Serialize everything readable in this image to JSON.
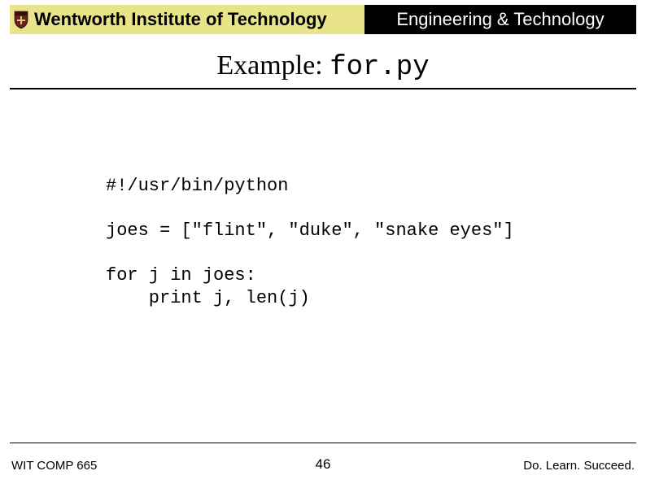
{
  "header": {
    "institution": "Wentworth Institute of Technology",
    "department": "Engineering & Technology"
  },
  "title": {
    "prefix": "Example: ",
    "code": "for.py"
  },
  "code": "#!/usr/bin/python\n\njoes = [\"flint\", \"duke\", \"snake eyes\"]\n\nfor j in joes:\n    print j, len(j)",
  "footer": {
    "left": "WIT COMP 665",
    "page": "46",
    "right": "Do. Learn. Succeed."
  }
}
